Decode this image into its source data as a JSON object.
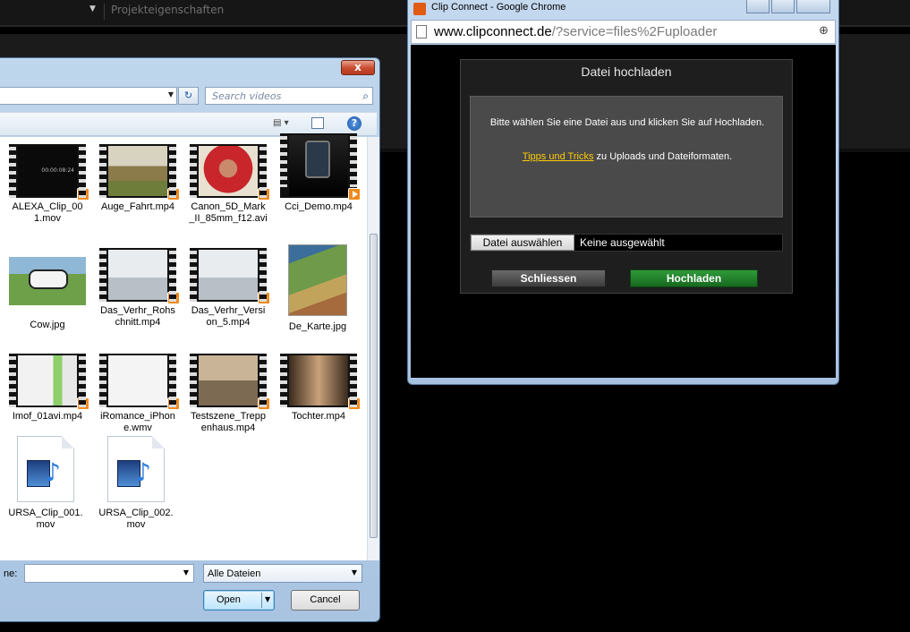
{
  "background_app": {
    "dropdown_arrow": "▼",
    "project_tab": "Projekteigenschaften"
  },
  "file_dialog": {
    "close_glyph": "x",
    "search_placeholder": "Search videos",
    "files": [
      {
        "name": "ALEXA_Clip_001.mov",
        "kind": "video"
      },
      {
        "name": "Auge_Fahrt.mp4",
        "kind": "video"
      },
      {
        "name": "Canon_5D_Mark_II_85mm_f12.avi",
        "kind": "video"
      },
      {
        "name": "Cci_Demo.mp4",
        "kind": "video"
      },
      {
        "name": "Cow.jpg",
        "kind": "image"
      },
      {
        "name": "Das_Verhr_Rohschnitt.mp4",
        "kind": "video"
      },
      {
        "name": "Das_Verhr_Version_5.mp4",
        "kind": "video"
      },
      {
        "name": "De_Karte.jpg",
        "kind": "image"
      },
      {
        "name": "Imof_01avi.mp4",
        "kind": "video"
      },
      {
        "name": "iRomance_iPhone.wmv",
        "kind": "video"
      },
      {
        "name": "Testszene_Treppenhaus.mp4",
        "kind": "video"
      },
      {
        "name": "Tochter.mp4",
        "kind": "video"
      },
      {
        "name": "URSA_Clip_001.mov",
        "kind": "media-file"
      },
      {
        "name": "URSA_Clip_002.mov",
        "kind": "media-file"
      }
    ],
    "filename_label": "ne:",
    "filename_value": "",
    "filetype_value": "Alle Dateien",
    "open_label": "Open",
    "cancel_label": "Cancel"
  },
  "chrome_window": {
    "title": "Clip Connect - Google Chrome",
    "url_domain": "www.clipconnect.de",
    "url_path": "/?service=files%2Fuploader",
    "upload_dialog": {
      "title": "Datei hochladen",
      "message": "Bitte wählen Sie eine Datei aus und klicken Sie auf Hochladen.",
      "tips_link": "Tipps und Tricks",
      "tips_rest": "zu Uploads und Dateiformaten.",
      "choose_file_label": "Datei auswählen",
      "no_file_text": "Keine ausgewählt",
      "close_label": "Schliessen",
      "upload_label": "Hochladen"
    }
  },
  "colors": {
    "accent_link": "#ffcb05",
    "upload_button": "#2f9a3a",
    "play_badge": "#f08a1c"
  }
}
